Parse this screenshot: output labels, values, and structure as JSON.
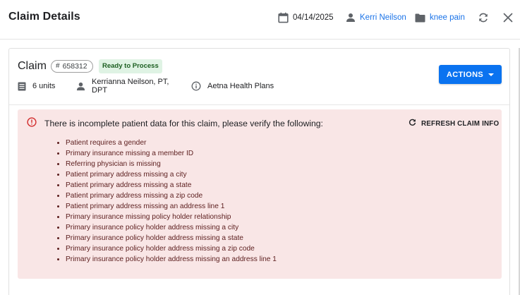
{
  "header": {
    "title": "Claim Details",
    "date": "04/14/2025",
    "patient": "Kerri Neilson",
    "case": "knee pain",
    "icons": [
      "calendar-icon",
      "person-icon",
      "folder-icon",
      "sync-icon",
      "close-icon"
    ]
  },
  "claim": {
    "title": "Claim",
    "number": "658312",
    "number_prefix": "#",
    "status": "Ready to Process",
    "units": "6 units",
    "provider": "Kerrianna Neilson, PT, DPT",
    "insurance": "Aetna Health Plans",
    "actions_label": "ACTIONS"
  },
  "alert": {
    "title": "There is incomplete patient data for this claim, please verify the following:",
    "refresh_label": "REFRESH CLAIM INFO",
    "items": [
      "Patient requires a gender",
      "Primary insurance missing a member ID",
      "Referring physician is missing",
      "Patient primary address missing a city",
      "Patient primary address missing a state",
      "Patient primary address missing a zip code",
      "Patient primary address missing an address line 1",
      "Primary insurance missing policy holder relationship",
      "Primary insurance policy holder address missing a city",
      "Primary insurance policy holder address missing a state",
      "Primary insurance policy holder address missing a zip code",
      "Primary insurance policy holder address missing an address line 1"
    ]
  },
  "colors": {
    "accent": "#0a73f0",
    "link": "#1a73e8",
    "status_bg": "#dff3e4",
    "status_text": "#1b5e20",
    "alert_bg": "#f9e6e6",
    "alert_icon": "#d32f2f",
    "alert_text": "#5c1e1e"
  }
}
